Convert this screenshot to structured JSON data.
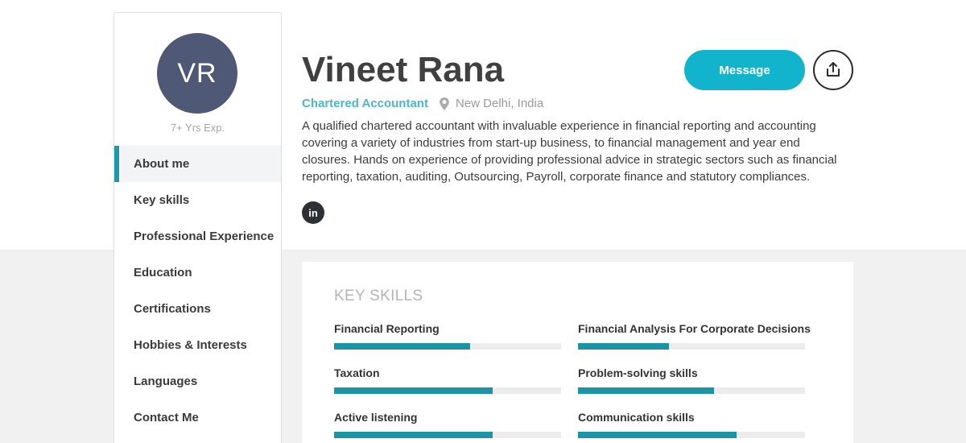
{
  "profile": {
    "initials": "VR",
    "experience": "7+ Yrs Exp.",
    "name": "Vineet Rana",
    "title": "Chartered Accountant",
    "location": "New Delhi, India",
    "bio": "A qualified chartered accountant with invaluable experience in financial reporting and accounting covering a variety of industries from start-up business, to financial management and year end closures. Hands on experience of providing professional advice in strategic sectors such as financial reporting, taxation, auditing, Outsourcing, Payroll, corporate finance and statutory compliances.",
    "linkedin_label": "in"
  },
  "sidebar": {
    "items": [
      {
        "label": "About me",
        "active": true
      },
      {
        "label": "Key skills",
        "active": false
      },
      {
        "label": "Professional Experience",
        "active": false
      },
      {
        "label": "Education",
        "active": false
      },
      {
        "label": "Certifications",
        "active": false
      },
      {
        "label": "Hobbies & Interests",
        "active": false
      },
      {
        "label": "Languages",
        "active": false
      },
      {
        "label": "Contact Me",
        "active": false
      }
    ]
  },
  "actions": {
    "message_label": "Message",
    "share_icon": "share-upload-icon"
  },
  "skills": {
    "heading": "KEY SKILLS",
    "items": [
      {
        "name": "Financial Reporting",
        "level": 0.6
      },
      {
        "name": "Financial Analysis For Corporate Decisions",
        "level": 0.4
      },
      {
        "name": "Taxation",
        "level": 0.7
      },
      {
        "name": "Problem-solving skills",
        "level": 0.6
      },
      {
        "name": "Active listening",
        "level": 0.7
      },
      {
        "name": "Communication skills",
        "level": 0.7
      }
    ]
  },
  "colors": {
    "accent": "#11b4cc",
    "bar": "#1b95a5",
    "avatar": "#4f5875",
    "title": "#49b7c7"
  }
}
